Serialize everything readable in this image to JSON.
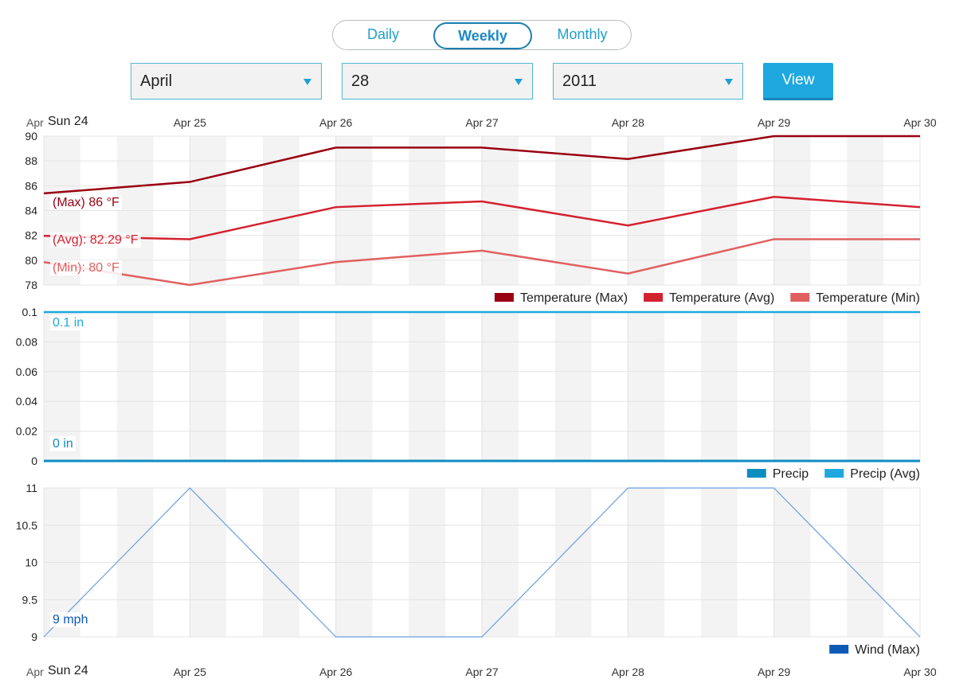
{
  "tabs": [
    {
      "label": "Daily"
    },
    {
      "label": "Weekly"
    },
    {
      "label": "Monthly"
    }
  ],
  "selectors": {
    "month": "April",
    "day": "28",
    "year": "2011",
    "view_label": "View"
  },
  "x_axis": {
    "top_labels": [
      "Apr 24",
      "Apr 25",
      "Apr 26",
      "Apr 27",
      "Apr 28",
      "Apr 29",
      "Apr 30"
    ],
    "first_day_tag": "Sun 24"
  },
  "colors": {
    "temp_max": "#990011",
    "temp_avg": "#d4212f",
    "temp_min": "#e06060",
    "precip": "#0e8ec0",
    "precip_avg": "#1ea8df",
    "wind": "#6a9fe0",
    "wind_legend": "#0c5ab5",
    "tab_accent": "#1e9fd0"
  },
  "chart_data": [
    {
      "type": "line",
      "categories": [
        "Apr 24",
        "Apr 25",
        "Apr 26",
        "Apr 27",
        "Apr 28",
        "Apr 29",
        "Apr 30"
      ],
      "series": [
        {
          "name": "Temperature (Max)",
          "values": [
            86,
            87,
            90,
            90,
            89,
            91,
            91
          ]
        },
        {
          "name": "Temperature (Avg)",
          "values": [
            82.29,
            82,
            84.8,
            85.3,
            83.2,
            85.7,
            84.8
          ]
        },
        {
          "name": "Temperature (Min)",
          "values": [
            80,
            78,
            80,
            81,
            79,
            82,
            82
          ]
        }
      ],
      "ylim": [
        78,
        91
      ],
      "yticks": [
        "90",
        "88",
        "86",
        "84",
        "82",
        "80",
        "78"
      ],
      "annotations": [
        "(Max) 86 °F",
        "(Avg): 82.29 °F",
        "(Min): 80 °F"
      ],
      "legend": "bottom-right"
    },
    {
      "type": "line",
      "categories": [
        "Apr 24",
        "Apr 25",
        "Apr 26",
        "Apr 27",
        "Apr 28",
        "Apr 29",
        "Apr 30"
      ],
      "series": [
        {
          "name": "Precip",
          "values": [
            0,
            0,
            0,
            0,
            0,
            0,
            0
          ]
        },
        {
          "name": "Precip (Avg)",
          "values": [
            0.1,
            0.1,
            0.1,
            0.1,
            0.1,
            0.1,
            0.1
          ]
        }
      ],
      "ylim": [
        0,
        0.1
      ],
      "yticks": [
        "0.1",
        "0.08",
        "0.06",
        "0.04",
        "0.02",
        "0"
      ],
      "annotations": [
        "0.1 in",
        "0 in"
      ],
      "legend": "bottom-right"
    },
    {
      "type": "line",
      "categories": [
        "Apr 24",
        "Apr 25",
        "Apr 26",
        "Apr 27",
        "Apr 28",
        "Apr 29",
        "Apr 30"
      ],
      "series": [
        {
          "name": "Wind (Max)",
          "values": [
            9,
            11,
            9,
            9,
            11,
            11,
            9
          ]
        }
      ],
      "ylim": [
        9,
        11
      ],
      "yticks": [
        "11",
        "10.5",
        "10",
        "9.5",
        "9"
      ],
      "annotations": [
        "9 mph"
      ],
      "legend": "bottom-right"
    }
  ]
}
